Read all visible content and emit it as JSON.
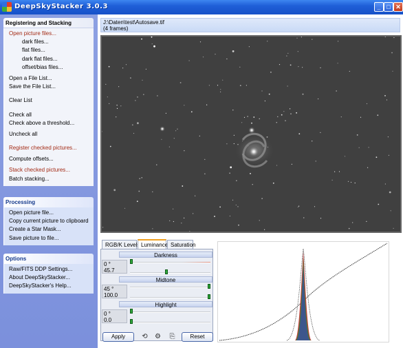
{
  "window": {
    "title": "DeepSkyStacker  3.0.3",
    "icon": "dss-app-icon",
    "controls": {
      "minimize": "_",
      "maximize": "□",
      "close": "✕"
    }
  },
  "sidebar": {
    "registering": {
      "title": "Registering and Stacking",
      "open_picture_files": "Open picture files...",
      "dark_files": "dark files...",
      "flat_files": "flat files...",
      "dark_flat_files": "dark flat files...",
      "offset_bias_files": "offset/bias files...",
      "open_file_list": "Open a File List...",
      "save_file_list": "Save the File List...",
      "clear_list": "Clear List",
      "check_all": "Check all",
      "check_above_threshold": "Check above a threshold...",
      "uncheck_all": "Uncheck all",
      "register_checked": "Register checked pictures...",
      "compute_offsets": "Compute offsets...",
      "stack_checked": "Stack checked pictures...",
      "batch_stacking": "Batch stacking..."
    },
    "processing": {
      "title": "Processing",
      "open_picture_file": "Open picture file...",
      "copy_to_clipboard": "Copy current picture to clipboard",
      "create_star_mask": "Create a Star Mask...",
      "save_picture": "Save picture to file..."
    },
    "options": {
      "title": "Options",
      "raw_fits_settings": "Raw/FITS DDP Settings...",
      "about": "About DeepSkyStacker...",
      "help": "DeepSkyStacker's Help..."
    }
  },
  "main": {
    "file_path": "J:\\Daten\\test\\Autosave.tif",
    "frames": "(4 frames)"
  },
  "tabs": {
    "rgb": "RGB/K Levels",
    "luminance": "Luminance",
    "saturation": "Saturation",
    "active": "luminance"
  },
  "luminance": {
    "darkness": {
      "label": "Darkness",
      "angle": "0 °",
      "value": "45.7",
      "slider1": 0.0,
      "slider2": 0.45
    },
    "midtone": {
      "label": "Midtone",
      "angle": "45 °",
      "value": "100.0",
      "slider1": 1.0,
      "slider2": 1.0
    },
    "highlight": {
      "label": "Highlight",
      "angle": "0 °",
      "value": "0.0",
      "slider1": 0.0,
      "slider2": 0.0
    }
  },
  "buttons": {
    "apply": "Apply",
    "reset": "Reset",
    "undo_icon": "undo-icon",
    "settings_icon": "settings-icon",
    "export_icon": "export-icon"
  },
  "colors": {
    "titlebar": "#1f5fd8",
    "sidebar": "#7b90dc",
    "red_link": "#a32a14",
    "slider_thumb": "#2fa63a"
  }
}
